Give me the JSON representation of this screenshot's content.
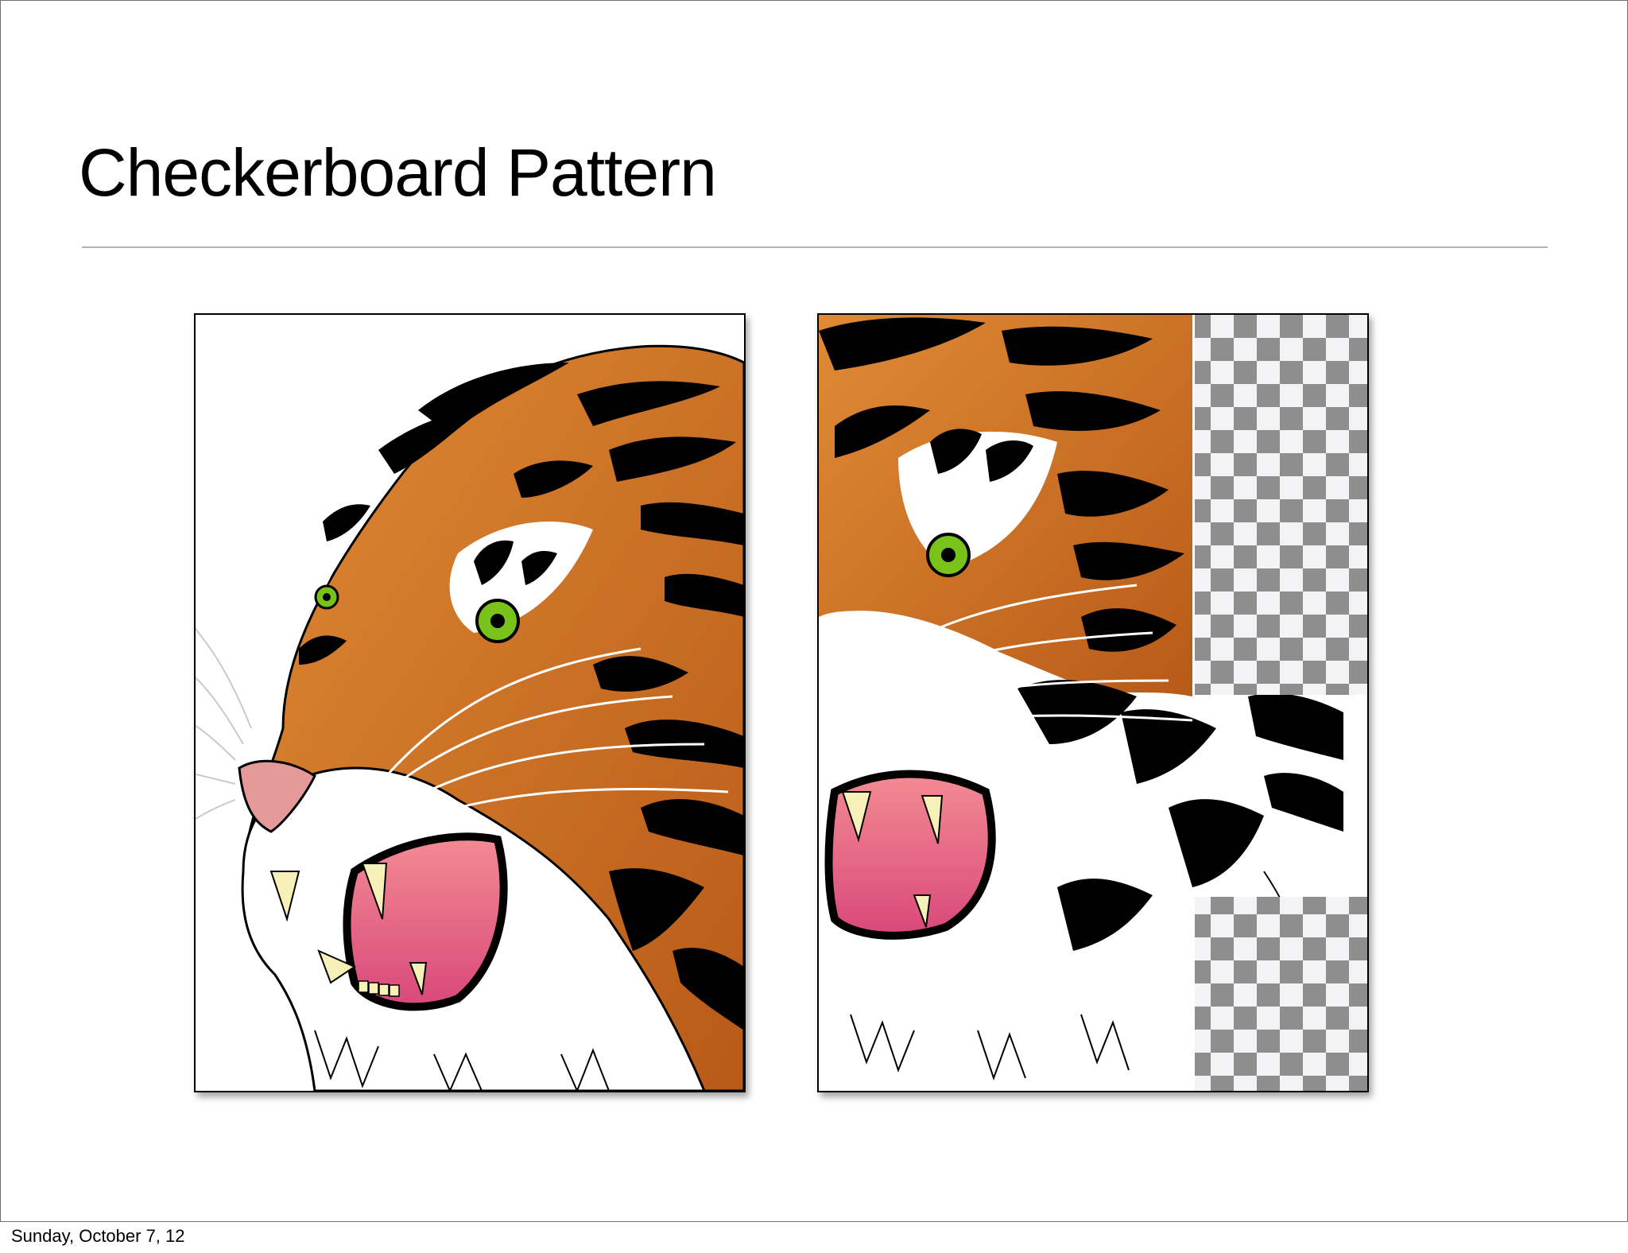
{
  "slide": {
    "title": "Checkerboard Pattern"
  },
  "panels": {
    "left": {
      "image": "tiger-head-illustration"
    },
    "right": {
      "image": "tiger-head-illustration-with-transparent-tiles",
      "pattern": "checkerboard-transparency"
    }
  },
  "footer": {
    "date": "Sunday, October 7, 12"
  },
  "colors": {
    "tiger_orange": "#d4762a",
    "tiger_stripe": "#000000",
    "eye_green": "#79c21a",
    "mouth_pink": "#e4607a",
    "fang_cream": "#f7f1b8",
    "checker_dark": "#8e8e8e",
    "checker_light": "#f3f3f6"
  }
}
